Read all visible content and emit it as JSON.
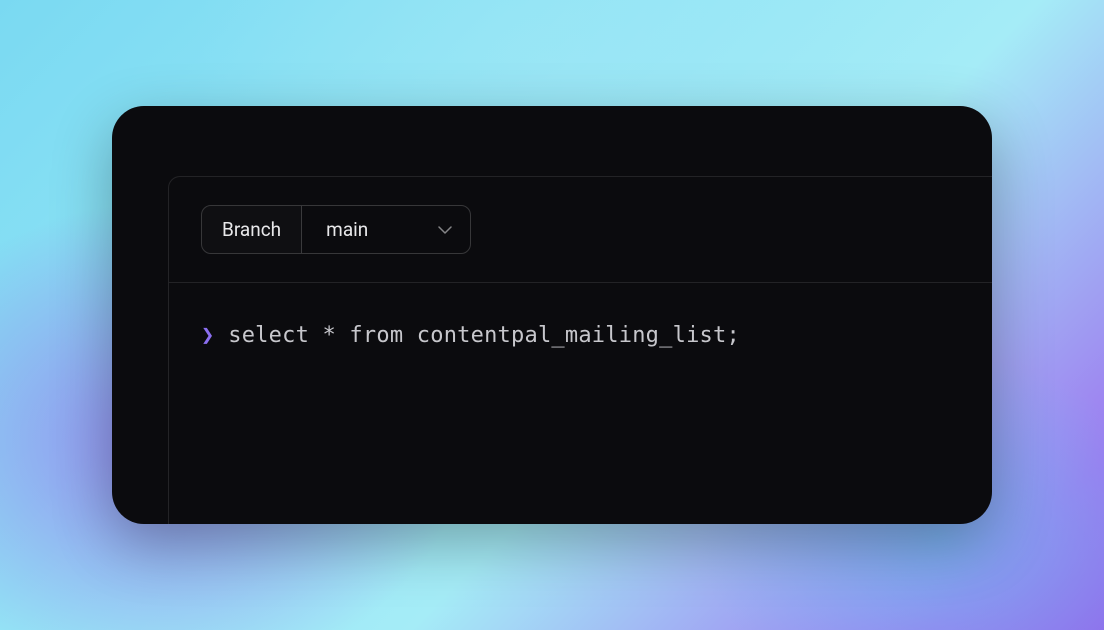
{
  "toolbar": {
    "branch_label": "Branch",
    "branch_value": "main"
  },
  "terminal": {
    "prompt_symbol": "❯",
    "query": "select * from contentpal_mailing_list;"
  },
  "colors": {
    "prompt": "#8b6ff0",
    "text": "#c7c7cc",
    "background": "#0b0b0e"
  }
}
